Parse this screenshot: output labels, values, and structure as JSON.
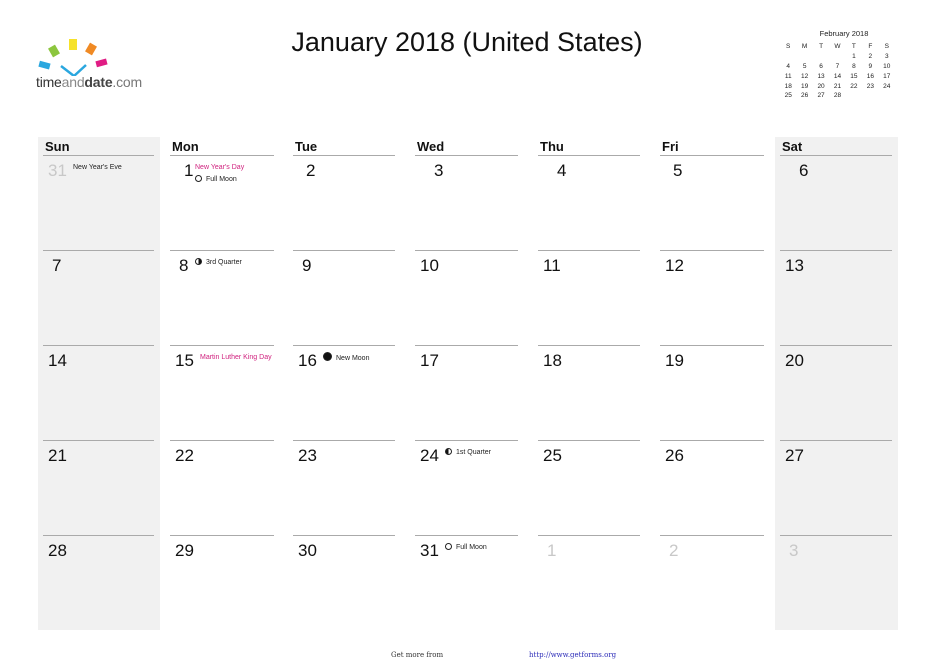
{
  "logo": {
    "text_a": "time",
    "text_b": "and",
    "text_c": "date",
    "text_d": ".com"
  },
  "title": "January 2018 (United States)",
  "mini_calendar": {
    "title": "February 2018",
    "weekdays": [
      "S",
      "M",
      "T",
      "W",
      "T",
      "F",
      "S"
    ],
    "weeks": [
      [
        "",
        "",
        "",
        "",
        "1",
        "2",
        "3"
      ],
      [
        "4",
        "5",
        "6",
        "7",
        "8",
        "9",
        "10"
      ],
      [
        "11",
        "12",
        "13",
        "14",
        "15",
        "16",
        "17"
      ],
      [
        "18",
        "19",
        "20",
        "21",
        "22",
        "23",
        "24"
      ],
      [
        "25",
        "26",
        "27",
        "28",
        "",
        "",
        ""
      ]
    ]
  },
  "weekdays": [
    "Sun",
    "Mon",
    "Tue",
    "Wed",
    "Thu",
    "Fri",
    "Sat"
  ],
  "weeks": [
    [
      {
        "day": "31",
        "muted": true,
        "events": [
          {
            "text": "New Year's Eve",
            "type": "observance"
          }
        ]
      },
      {
        "day": "1",
        "events": [
          {
            "text": "New Year's Day",
            "type": "holiday"
          },
          {
            "text": "Full Moon",
            "type": "moon",
            "moon": "full"
          }
        ]
      },
      {
        "day": "2"
      },
      {
        "day": "3"
      },
      {
        "day": "4"
      },
      {
        "day": "5"
      },
      {
        "day": "6"
      }
    ],
    [
      {
        "day": "7"
      },
      {
        "day": "8",
        "events": [
          {
            "text": "3rd Quarter",
            "type": "moon",
            "moon": "q3"
          }
        ]
      },
      {
        "day": "9"
      },
      {
        "day": "10"
      },
      {
        "day": "11"
      },
      {
        "day": "12"
      },
      {
        "day": "13"
      }
    ],
    [
      {
        "day": "14"
      },
      {
        "day": "15",
        "events": [
          {
            "text": "Martin Luther King Day",
            "type": "holiday"
          }
        ]
      },
      {
        "day": "16",
        "events": [
          {
            "text": "New Moon",
            "type": "moon",
            "moon": "new"
          }
        ]
      },
      {
        "day": "17"
      },
      {
        "day": "18"
      },
      {
        "day": "19"
      },
      {
        "day": "20"
      }
    ],
    [
      {
        "day": "21"
      },
      {
        "day": "22"
      },
      {
        "day": "23"
      },
      {
        "day": "24",
        "events": [
          {
            "text": "1st Quarter",
            "type": "moon",
            "moon": "q1"
          }
        ]
      },
      {
        "day": "25"
      },
      {
        "day": "26"
      },
      {
        "day": "27"
      }
    ],
    [
      {
        "day": "28"
      },
      {
        "day": "29"
      },
      {
        "day": "30"
      },
      {
        "day": "31",
        "events": [
          {
            "text": "Full Moon",
            "type": "moon",
            "moon": "full"
          }
        ]
      },
      {
        "day": "1",
        "muted": true
      },
      {
        "day": "2",
        "muted": true
      },
      {
        "day": "3",
        "muted": true
      }
    ]
  ],
  "colors": {
    "holiday": "#d0217e",
    "weekend_bg": "#f1f1f1",
    "muted_day": "#c8c8c8",
    "link": "#2b2bb8"
  },
  "footer": {
    "text": "Get more from",
    "link": "http://www.getforms.org"
  }
}
